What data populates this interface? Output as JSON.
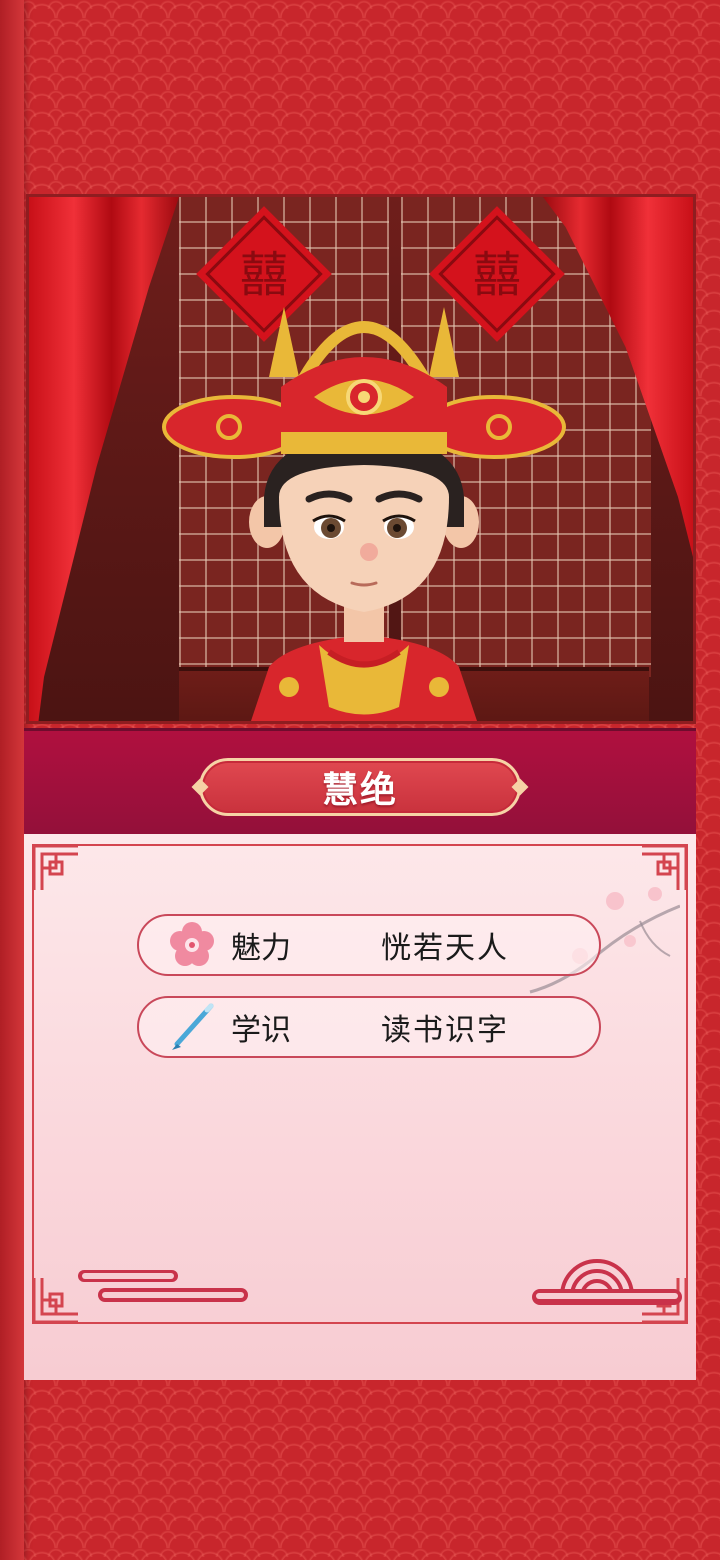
{
  "character": {
    "name": "慧绝"
  },
  "stats": [
    {
      "label": "魅力",
      "value": "恍若天人",
      "icon": "plum-blossom-icon"
    },
    {
      "label": "学识",
      "value": "读书识字",
      "icon": "brush-pen-icon"
    }
  ],
  "colors": {
    "background_red": "#c8262c",
    "ribbon": "#a3103c",
    "name_plate": "#d63c46",
    "card_bg": "#fbe0e4",
    "frame": "#d4454f"
  }
}
